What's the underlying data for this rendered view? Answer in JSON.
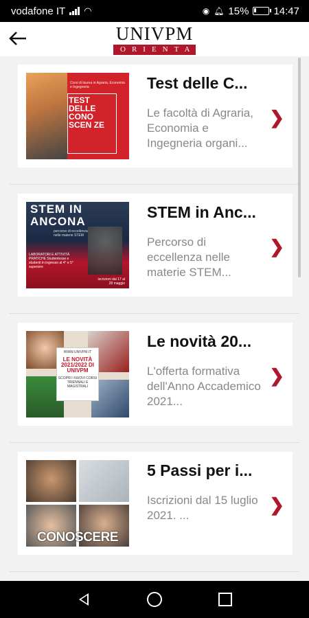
{
  "status_bar": {
    "carrier": "vodafone IT",
    "battery": "15%",
    "battery_level": 0.15,
    "time": "14:47"
  },
  "header": {
    "logo_main": "UNIVPM",
    "logo_sub": "ORIENTA"
  },
  "items": [
    {
      "title": "Test delle C...",
      "description": "Le facoltà di Agraria, Economia e Ingegneria organi...",
      "thumb_small": "Corsi di laurea in Agraria, Economia e Ingegneria",
      "thumb_text": "TEST DELLE CONO SCEN ZE"
    },
    {
      "title": "STEM in Anc...",
      "description": "Percorso di eccellenza nelle materie STEM...",
      "thumb_heading": "STEM IN ANCONA",
      "thumb_sub": "percorso di eccellenza nelle materie STEM",
      "thumb_body": "LABORATORI E ATTIVITÀ PRATICHE Studentesse e studenti in ingresso al 4° e 5° superiore",
      "thumb_date": "iscrizioni dal 17 al 28 maggio"
    },
    {
      "title": "Le novità 20...",
      "description": "L'offerta formativa dell'Anno Accademico 2021...",
      "thumb_url": "WWW.UNIVPM.IT",
      "thumb_heading": "LE NOVITÀ 2021/2022 DI UNIVPM",
      "thumb_sub": "SCOPRI I NUOVI CORSI TRIENNALI E MAGISTRALI"
    },
    {
      "title": "5 Passi per i...",
      "description": "Iscrizioni dal 15 luglio 2021. ...",
      "thumb_word": "CONOSCERE"
    }
  ]
}
